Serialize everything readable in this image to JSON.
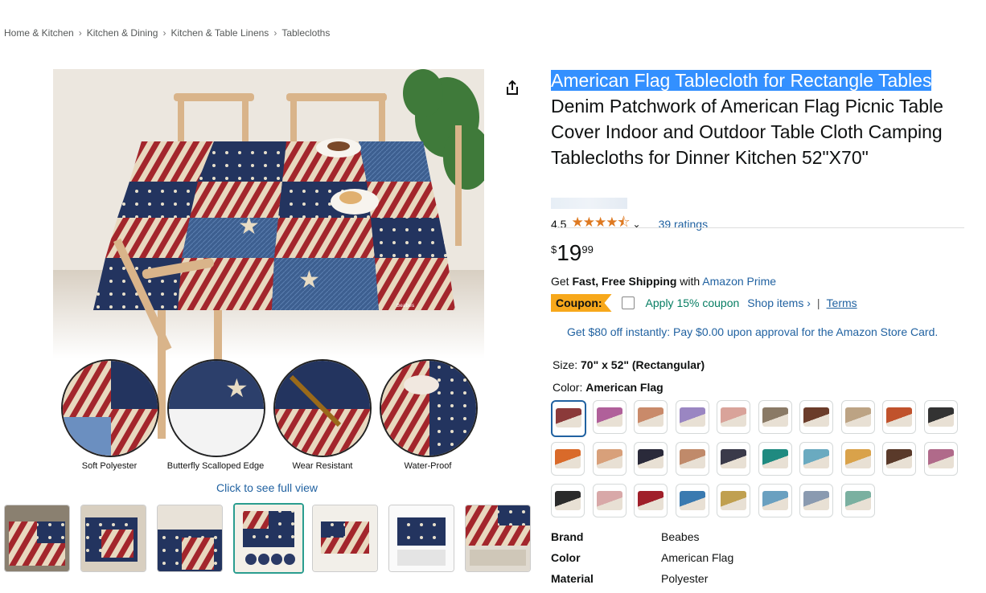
{
  "breadcrumb": [
    "Home & Kitchen",
    "Kitchen & Dining",
    "Kitchen & Table Linens",
    "Tablecloths"
  ],
  "gallery": {
    "full_view_link": "Click to see full view",
    "feature_labels": [
      "Soft Polyester",
      "Butterfly Scalloped Edge",
      "Wear Resistant",
      "Water-Proof"
    ],
    "brand_tag": "Beabes",
    "thumbnail_count": 7,
    "selected_thumbnail": 4
  },
  "product": {
    "title_highlighted": "American Flag Tablecloth for Rectangle Tables",
    "title_rest": "Denim Patchwork of American Flag Picnic Table Cover Indoor and Outdoor Table Cloth Camping Tablecloths for Dinner Kitchen 52\"X70\"",
    "rating_value": "4.5",
    "rating_stars": "★★★★⯪",
    "ratings_count": "39 ratings",
    "price_symbol": "$",
    "price_whole": "19",
    "price_fraction": "99"
  },
  "shipping": {
    "prefix": "Get ",
    "bold": "Fast, Free Shipping",
    "middle": " with ",
    "link": "Amazon Prime"
  },
  "coupon": {
    "badge": "Coupon:",
    "apply_text": "Apply 15% coupon",
    "shop_items": "Shop items ›",
    "separator": "|",
    "terms": "Terms"
  },
  "store_card_offer": "Get $80 off instantly: Pay $0.00 upon approval for the Amazon Store Card.",
  "size": {
    "label": "Size: ",
    "value": "70\" x 52\" (Rectangular)"
  },
  "color": {
    "label": "Color: ",
    "value": "American Flag",
    "swatch_colors": [
      "#8b3a3a",
      "#b0609a",
      "#c98a6a",
      "#9a86c2",
      "#d9a39a",
      "#8a7a66",
      "#6b3c2a",
      "#bca384",
      "#c0522c",
      "#333333",
      "#d96a2a",
      "#d8a07a",
      "#2a2a3a",
      "#c08a6a",
      "#3a3a4a",
      "#1f8a80",
      "#6aaac0",
      "#d9a24a",
      "#5a3a2a",
      "#b06a8a",
      "#2a2a2a",
      "#d8a8a8",
      "#a01f2a",
      "#3a7ab0",
      "#c0a050",
      "#6aa0c0",
      "#8a9ab0",
      "#7ab0a0"
    ],
    "selected_index": 0
  },
  "attributes": [
    {
      "key": "Brand",
      "value": "Beabes"
    },
    {
      "key": "Color",
      "value": "American Flag"
    },
    {
      "key": "Material",
      "value": "Polyester"
    }
  ]
}
